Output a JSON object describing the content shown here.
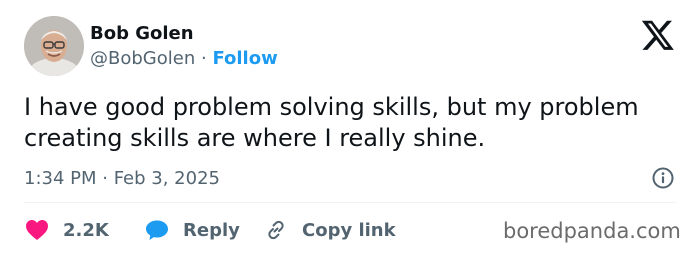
{
  "author": {
    "display_name": "Bob Golen",
    "handle": "@BobGolen",
    "separator": "·",
    "follow_label": "Follow"
  },
  "tweet": {
    "text": "I have good problem solving skills, but my problem creating skills are where I really shine.",
    "timestamp": "1:34 PM · Feb 3, 2025"
  },
  "actions": {
    "likes_count": "2.2K",
    "reply_label": "Reply",
    "copy_link_label": "Copy link"
  },
  "watermark": "boredpanda.com",
  "icons": {
    "logo": "x-logo-icon",
    "info": "info-icon",
    "like": "heart-icon",
    "reply": "speech-bubble-icon",
    "copy": "link-icon"
  },
  "colors": {
    "follow": "#1d9bf0",
    "like": "#f91880",
    "reply": "#1d9bf0",
    "secondary_text": "#536471"
  }
}
